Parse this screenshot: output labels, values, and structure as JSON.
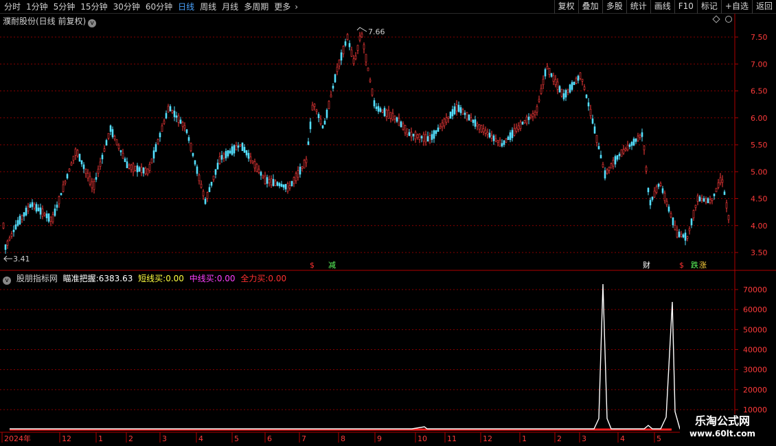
{
  "toolbar": {
    "periods": [
      "分时",
      "1分钟",
      "5分钟",
      "15分钟",
      "30分钟",
      "60分钟",
      "日线",
      "周线",
      "月线",
      "多周期",
      "更多"
    ],
    "active_period": "日线",
    "more_arrow": "›",
    "tools": [
      "复权",
      "叠加",
      "多股",
      "统计",
      "画线",
      "F10",
      "标记",
      "+自选",
      "返回"
    ]
  },
  "main_chart": {
    "title": "濮耐股份(日线 前复权)",
    "title_button": "v",
    "high_label": "7.66",
    "low_label": "3.41",
    "y_ticks": [
      "7.50",
      "7.00",
      "6.50",
      "6.00",
      "5.50",
      "5.00",
      "4.50",
      "4.00",
      "3.50"
    ],
    "markers": [
      {
        "text": "$",
        "color": "#ff3030"
      },
      {
        "text": "减",
        "color": "#5fff5f"
      },
      {
        "text": "财",
        "color": "#ffffff"
      },
      {
        "text": "$",
        "color": "#ff3030"
      },
      {
        "text": "跌",
        "color": "#5fff5f"
      },
      {
        "text": "涨",
        "color": "#ffd23c"
      }
    ]
  },
  "indicator": {
    "button": "v",
    "name": "股朋指标网",
    "fields": [
      {
        "label": "瞄准把握:",
        "value": "6383.63",
        "color": "#ffffff"
      },
      {
        "label": "短线买:",
        "value": "0.00",
        "color": "#ffff40"
      },
      {
        "label": "中线买:",
        "value": "0.00",
        "color": "#ff40ff"
      },
      {
        "label": "全力买:",
        "value": "0.00",
        "color": "#ff3030"
      }
    ],
    "y_ticks": [
      "70000",
      "60000",
      "50000",
      "40000",
      "30000",
      "20000",
      "10000"
    ]
  },
  "x_axis": {
    "labels": [
      "2024年",
      "12",
      "1",
      "2",
      "3",
      "4",
      "5",
      "6",
      "7",
      "8",
      "9",
      "10",
      "11",
      "12",
      "1",
      "2",
      "3",
      "4",
      "5"
    ]
  },
  "colors": {
    "up": "#ff3b3b",
    "down": "#54e0ff",
    "axis": "#b00000",
    "grid": "#8a0000",
    "tick_text": "#ff3b3b",
    "line": "#ffffff"
  },
  "watermark": {
    "main": "乐淘公式网",
    "sub": "www.60lt.com"
  }
}
